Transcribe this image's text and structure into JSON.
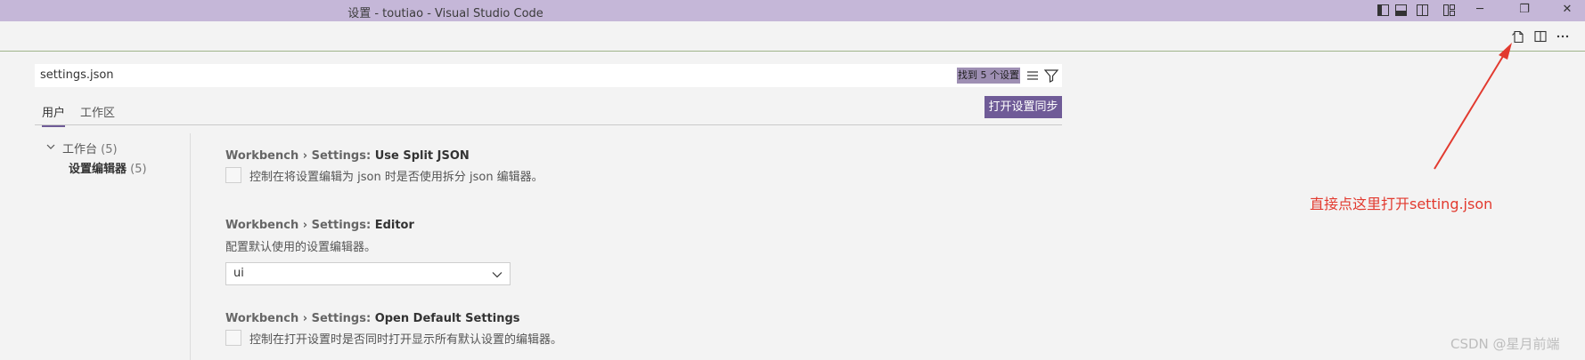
{
  "window": {
    "title": "设置 - toutiao - Visual Studio Code",
    "controls": {
      "minimize": "─",
      "restore": "❐",
      "close": "✕"
    }
  },
  "search": {
    "value": "settings.json",
    "result_badge": "找到 5 个设置"
  },
  "tabs": [
    {
      "label": "用户",
      "active": true
    },
    {
      "label": "工作区",
      "active": false
    }
  ],
  "sync_button": "打开设置同步",
  "toc": {
    "group": {
      "label": "工作台",
      "count": "(5)"
    },
    "child": {
      "label": "设置编辑器",
      "count": "(5)"
    }
  },
  "settings": [
    {
      "category": "Workbench › Settings: ",
      "name": "Use Split JSON",
      "type": "checkbox",
      "checked": false,
      "description": "控制在将设置编辑为 json 时是否使用拆分 json 编辑器。"
    },
    {
      "category": "Workbench › Settings: ",
      "name": "Editor",
      "type": "select",
      "description": "配置默认使用的设置编辑器。",
      "value": "ui"
    },
    {
      "category": "Workbench › Settings: ",
      "name": "Open Default Settings",
      "type": "checkbox",
      "checked": false,
      "description": "控制在打开设置时是否同时打开显示所有默认设置的编辑器。"
    }
  ],
  "annotation": "直接点这里打开setting.json",
  "watermark": "CSDN @星月前端",
  "colors": {
    "titlebar": "#c5b7d8",
    "accent": "#6f5b97",
    "annotation": "#e23a2f"
  }
}
